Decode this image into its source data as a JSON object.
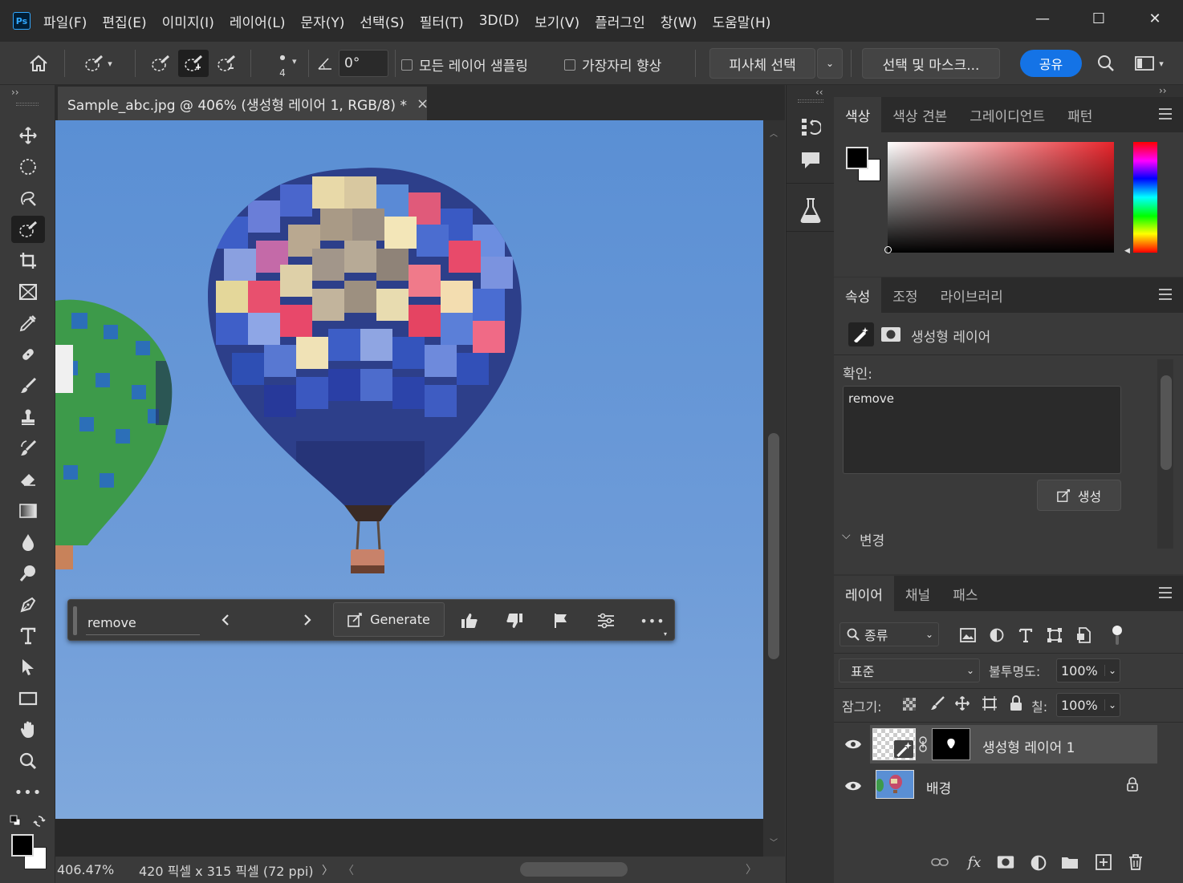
{
  "app": {
    "logo": "Ps"
  },
  "menu": [
    "파일(F)",
    "편집(E)",
    "이미지(I)",
    "레이어(L)",
    "문자(Y)",
    "선택(S)",
    "필터(T)",
    "3D(D)",
    "보기(V)",
    "플러그인",
    "창(W)",
    "도움말(H)"
  ],
  "window_controls": {
    "minimize": "—",
    "maximize": "☐",
    "close": "✕"
  },
  "options": {
    "brush_size": "4",
    "angle": "0°",
    "sample_all_layers": "모든 레이어 샘플링",
    "enhance_edge": "가장자리 향상",
    "select_subject": "피사체 선택",
    "select_and_mask": "선택 및 마스크...",
    "share": "공유"
  },
  "document": {
    "tab_title": "Sample_abc.jpg @ 406% (생성형 레이어 1, RGB/8) *",
    "close": "×",
    "zoom": "406.47%",
    "size_info": "420 픽셀 x 315 픽셀 (72 ppi)"
  },
  "context_bar": {
    "prompt": "remove",
    "generate": "Generate"
  },
  "color_panel": {
    "tabs": [
      "색상",
      "색상 견본",
      "그레이디언트",
      "패턴"
    ],
    "active_tab": 0,
    "hue_color": "#e8242b"
  },
  "properties_panel": {
    "tabs": [
      "속성",
      "조정",
      "라이브러리"
    ],
    "active_tab": 0,
    "layer_type": "생성형 레이어",
    "prompt_label": "확인:",
    "prompt_value": "remove",
    "generate_button": "생성",
    "variations_label": "변경"
  },
  "layers_panel": {
    "tabs": [
      "레이어",
      "채널",
      "패스"
    ],
    "active_tab": 0,
    "filter_label": "종류",
    "blend_mode": "표준",
    "opacity_label": "불투명도:",
    "opacity": "100%",
    "lock_label": "잠그기:",
    "fill_label": "칠:",
    "fill": "100%",
    "layers": [
      {
        "name": "생성형 레이어 1",
        "selected": true
      },
      {
        "name": "배경",
        "locked": true
      }
    ]
  }
}
